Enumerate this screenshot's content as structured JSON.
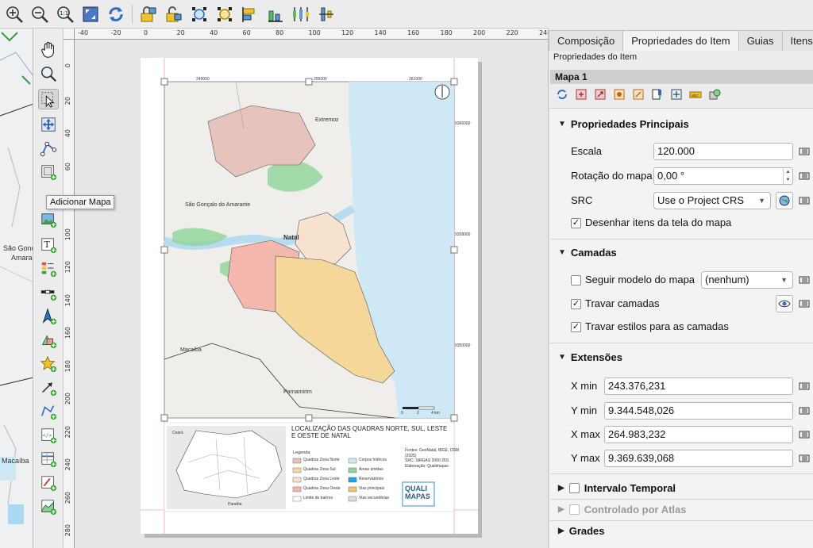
{
  "tooltip": {
    "text": "Adicionar Mapa"
  },
  "toolbar": {
    "icons": [
      "zoom-in-icon",
      "zoom-out-icon",
      "zoom-actual-icon",
      "zoom-full-icon",
      "refresh-icon",
      "lock-icon",
      "unlock-icon",
      "select-all-icon",
      "deselect-icon",
      "align-icon",
      "distribute-icon",
      "resize-icon",
      "raise-icon"
    ]
  },
  "bg_map": {
    "label1": "São Gonç",
    "label2": "Amara",
    "label3": "Macaíba"
  },
  "rulers": {
    "h": [
      "-40",
      "-20",
      "0",
      "20",
      "40",
      "60",
      "80",
      "100",
      "120",
      "140",
      "160",
      "180",
      "200",
      "220",
      "240"
    ],
    "v": [
      "0",
      "20",
      "40",
      "60",
      "80",
      "100",
      "120",
      "140",
      "160",
      "180",
      "200",
      "220",
      "240",
      "260",
      "280"
    ]
  },
  "panel": {
    "tabs": [
      "Composição",
      "Propriedades do Item",
      "Guias",
      "Itens"
    ],
    "subheading": "Propriedades do Item",
    "item_title": "Mapa 1",
    "main_props": {
      "heading": "Propriedades Principais",
      "scale_label": "Escala",
      "scale_value": "120.000",
      "rotation_label": "Rotação do mapa",
      "rotation_value": "0,00 °",
      "crs_label": "SRC",
      "crs_value": "Use o Project CRS",
      "draw_items_label": "Desenhar itens da tela do mapa"
    },
    "layers": {
      "heading": "Camadas",
      "follow_theme_label": "Seguir modelo do mapa",
      "follow_theme_value": "(nenhum)",
      "lock_layers_label": "Travar camadas",
      "lock_styles_label": "Travar estilos para as camadas"
    },
    "extents": {
      "heading": "Extensões",
      "xmin_label": "X min",
      "xmin_value": "243.376,231",
      "ymin_label": "Y min",
      "ymin_value": "9.344.548,026",
      "xmax_label": "X max",
      "xmax_value": "264.983,232",
      "ymax_label": "Y max",
      "ymax_value": "9.369.639,068"
    },
    "temporal": {
      "heading": "Intervalo Temporal"
    },
    "atlas": {
      "heading": "Controlado por Atlas"
    },
    "grids": {
      "heading": "Grades"
    }
  },
  "layout": {
    "title": "LOCALIZAÇÃO DAS QUADRAS NORTE, SUL, LESTE E OESTE DE NATAL",
    "legend_title": "Legenda",
    "legend_items": [
      "Quadras Zona Norte",
      "Quadras Zona Sul",
      "Quadras Zona Leste",
      "Quadras Zona Oeste",
      "Limite de bairros",
      "Corpos hídricos",
      "Áreas úmidas",
      "Reservatórios",
      "Vias principais",
      "Vias secundárias"
    ],
    "legend_colors": [
      "#e6c3bd",
      "#f5d79a",
      "#f6e2cf",
      "#f4b7ae",
      "#ffffff",
      "#cfe8f6",
      "#8ed59a",
      "#1fa3e0",
      "#f2c46b",
      "#dddddd"
    ],
    "sources": [
      "Fontes: GeoNatal, IBGE, OSM",
      "(2025)",
      "SRC: SIRGAS 2000 25S",
      "Elaboração: Qualimapas"
    ],
    "logo_lines": [
      "QUALI",
      "MAPAS"
    ],
    "place_labels": [
      "Extremoz",
      "São Gonçalo do Amarante",
      "Natal",
      "Macaíba",
      "Parnamirim"
    ],
    "coords_top": [
      "249000",
      "255000",
      "261000"
    ],
    "coords_side": [
      "9366000",
      "9358000",
      "9350000"
    ],
    "scale_ticks": [
      "0",
      "2",
      "4 km"
    ],
    "inset_labels": [
      "Ceará",
      "Paraíba"
    ]
  }
}
